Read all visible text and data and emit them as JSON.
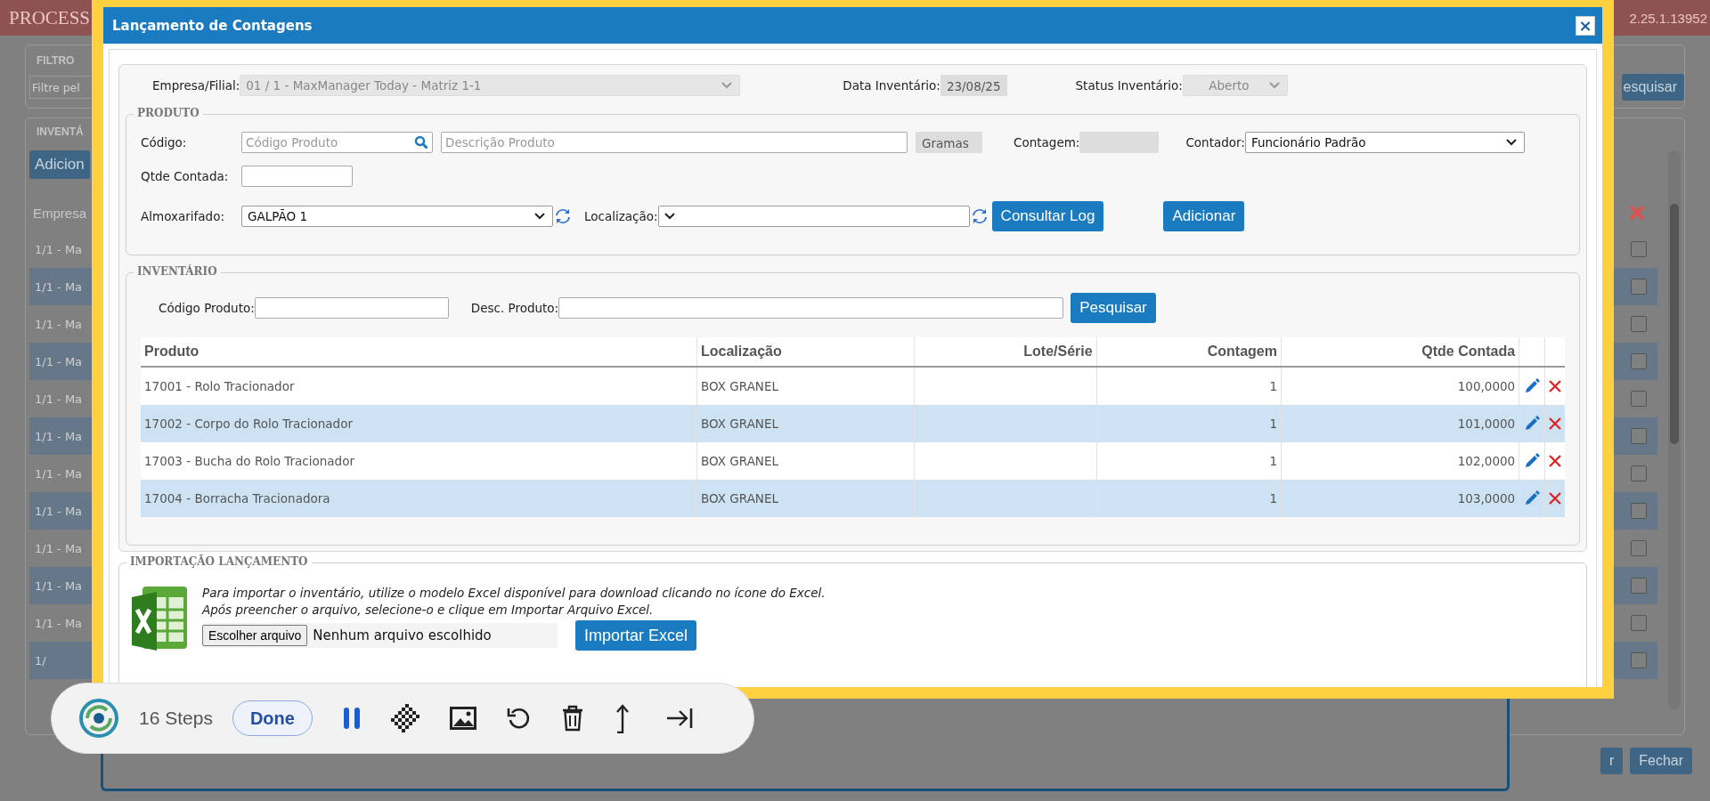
{
  "page": {
    "title": "PROCESS",
    "version": "2.25.1.13952",
    "filter": {
      "legend": "FILTRO",
      "placeholder": "Filtre pel",
      "search_button": "esquisar"
    },
    "inventory": {
      "legend": "INVENTÁ",
      "add_button": "Adicion",
      "column_1": "Empresa",
      "rows": [
        {
          "text": "1/1 - Ma",
          "checked": false
        },
        {
          "text": "1/1 - Ma",
          "checked": false
        },
        {
          "text": "1/1 - Ma",
          "checked": false
        },
        {
          "text": "1/1 - Ma",
          "checked": false
        },
        {
          "text": "1/1 - Ma",
          "checked": false
        },
        {
          "text": "1/1 - Ma",
          "checked": false
        },
        {
          "text": "1/1 - Ma",
          "checked": false
        },
        {
          "text": "1/1 - Ma",
          "checked": false
        },
        {
          "text": "1/1 - Ma",
          "checked": false
        },
        {
          "text": "1/1 - Ma",
          "checked": false
        },
        {
          "text": "1/1 - Ma",
          "checked": false
        },
        {
          "text": "1/",
          "checked": false
        }
      ]
    },
    "footer_buttons": [
      "r",
      "Fechar"
    ]
  },
  "dialog": {
    "title": "Lançamento de Contagens",
    "close": "×",
    "header": {
      "branch_label": "Empresa/Filial:",
      "branch": {
        "value": "01 / 1 - MaxManager Today - Matriz 1-1",
        "disabled": true
      },
      "date_label": "Data Inventário:",
      "date": {
        "value": "23/08/25",
        "disabled": true
      },
      "status_label": "Status Inventário:",
      "status": {
        "value": "Aberto",
        "disabled": true
      }
    },
    "produto": {
      "legend": "PRODUTO",
      "code_label": "Código:",
      "code": {
        "placeholder": "Código Produto"
      },
      "description": {
        "placeholder": "Descrição Produto"
      },
      "unit": {
        "value": "Gramas",
        "disabled": true
      },
      "count_label": "Contagem:",
      "count": {
        "disabled": true
      },
      "counter_label": "Contador:",
      "counter": {
        "value": "Funcionário Padrão",
        "disabled": false
      },
      "qty_label": "Qtde Contada:",
      "warehouse_label": "Almoxarifado:",
      "warehouse": {
        "value": "GALPÃO 1",
        "disabled": false
      },
      "location_label": "Localização:",
      "location": {
        "disabled": false
      },
      "buttons": [
        "Consultar Log",
        "Adicionar"
      ]
    },
    "inventario": {
      "legend": "INVENTÁRIO",
      "code_label": "Código Produto:",
      "desc_label": "Desc. Produto:",
      "search_button": "Pesquisar",
      "columns": [
        "Produto",
        "Localização",
        "Lote/Série",
        "Contagem",
        "Qtde Contada"
      ],
      "rows": [
        {
          "produto": "17001 - Rolo Tracionador",
          "localizacao": "BOX GRANEL",
          "contagem": "1",
          "qtde": "100,0000"
        },
        {
          "produto": "17002 - Corpo do Rolo Tracionador",
          "localizacao": "BOX GRANEL",
          "contagem": "1",
          "qtde": "101,0000"
        },
        {
          "produto": "17003 - Bucha do Rolo Tracionador",
          "localizacao": "BOX GRANEL",
          "contagem": "1",
          "qtde": "102,0000"
        },
        {
          "produto": "17004 - Borracha Tracionadora",
          "localizacao": "BOX GRANEL",
          "contagem": "1",
          "qtde": "103,0000"
        }
      ]
    },
    "importacao": {
      "legend": "IMPORTAÇÃO LANÇAMENTO",
      "text_1": "Para importar o inventário, utilize o modelo Excel disponível para download clicando no ícone do Excel.",
      "text_2": "Após preencher o arquivo, selecione-o e clique em Importar Arquivo Excel.",
      "file_button": "Escolher arquivo",
      "file_status": "Nenhum arquivo escolhido",
      "import_button": "Importar Excel"
    }
  },
  "recorder": {
    "steps": "16 Steps",
    "done": "Done"
  }
}
